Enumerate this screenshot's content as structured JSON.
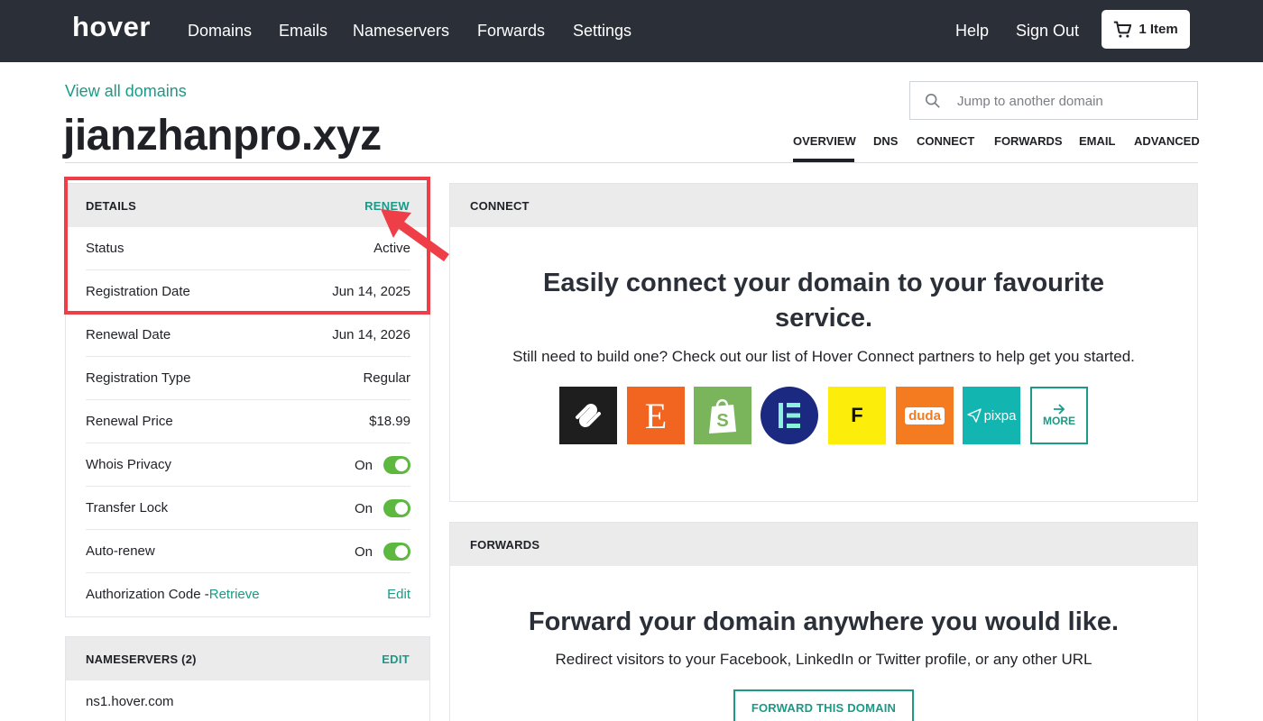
{
  "brand": {
    "logo_text": "hover",
    "accent": "#1a9a87",
    "nav_bg": "#2b2f38",
    "highlight": "#ee3e48"
  },
  "nav": {
    "links": [
      "Domains",
      "Emails",
      "Nameservers",
      "Forwards",
      "Settings"
    ],
    "help": "Help",
    "sign_out": "Sign Out",
    "cart_label": "1 Item"
  },
  "header": {
    "view_all": "View all domains",
    "domain": "jianzhanpro.xyz",
    "search_placeholder": "Jump to another domain",
    "tabs": [
      "OVERVIEW",
      "DNS",
      "CONNECT",
      "FORWARDS",
      "EMAIL",
      "ADVANCED"
    ],
    "active_tab": "OVERVIEW"
  },
  "details": {
    "title": "DETAILS",
    "action": "RENEW",
    "rows": [
      {
        "label": "Status",
        "value": "Active"
      },
      {
        "label": "Registration Date",
        "value": "Jun 14, 2025"
      },
      {
        "label": "Renewal Date",
        "value": "Jun 14, 2026"
      },
      {
        "label": "Registration Type",
        "value": "Regular"
      },
      {
        "label": "Renewal Price",
        "value": "$18.99"
      }
    ],
    "toggles": [
      {
        "label": "Whois Privacy",
        "value": "On"
      },
      {
        "label": "Transfer Lock",
        "value": "On"
      },
      {
        "label": "Auto-renew",
        "value": "On"
      }
    ],
    "auth_label": "Authorization Code -",
    "auth_link": "Retrieve",
    "auth_action": "Edit"
  },
  "nameservers": {
    "title": "NAMESERVERS (2)",
    "action": "EDIT",
    "items": [
      "ns1.hover.com"
    ]
  },
  "connect": {
    "title": "CONNECT",
    "heading_line1": "Easily connect your domain to your favourite",
    "heading_line2": "service.",
    "subtext": "Still need to build one? Check out our list of Hover Connect partners to help get you started.",
    "partners": [
      {
        "name": "squarespace-logo-icon",
        "color": "#1e1e1e"
      },
      {
        "name": "etsy-logo-icon",
        "color": "#f16521",
        "glyph": "E"
      },
      {
        "name": "shopify-logo-icon",
        "color": "#7ab55c",
        "glyph": "S"
      },
      {
        "name": "elementor-logo-icon",
        "color": "#1b2a80"
      },
      {
        "name": "framer-logo-icon",
        "color": "#fcee0a",
        "glyph": "F"
      },
      {
        "name": "duda-logo-icon",
        "color": "#f47b20",
        "glyph": "duda"
      },
      {
        "name": "pixpa-logo-icon",
        "color": "#12b5b0",
        "glyph": "pixpa"
      }
    ],
    "more_label": "MORE"
  },
  "forwards": {
    "title": "FORWARDS",
    "heading": "Forward your domain anywhere you would like.",
    "subtext": "Redirect visitors to your Facebook, LinkedIn or Twitter profile, or any other URL",
    "button": "FORWARD THIS DOMAIN"
  }
}
